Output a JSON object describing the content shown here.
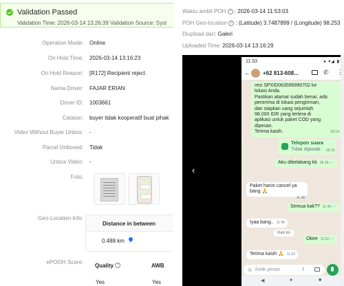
{
  "banner": {
    "title": "Validation Passed",
    "meta": "Validation Time: 2026-03-14 13:26:39    Validation Source: Syst"
  },
  "details": [
    {
      "label": "Operation Mode:",
      "value": "Online"
    },
    {
      "label": "On Hold Time:",
      "value": "2026-03-14 13:16:23"
    },
    {
      "label": "On Hold Reason:",
      "value": "[R172] Recipient reject"
    },
    {
      "label": "Nama Driver:",
      "value": "FAJAR ERIAN"
    },
    {
      "label": "Driver ID:",
      "value": "1003661"
    },
    {
      "label": "Catatan:",
      "value": "buyer tidak kooperatif buat pihak"
    },
    {
      "label": "Video Without Buyer Unbox:",
      "value": "-"
    },
    {
      "label": "Parcel Unboxed:",
      "value": "Tidak"
    },
    {
      "label": "Unbox Video:",
      "value": "-"
    },
    {
      "label": "Foto:",
      "value": ""
    },
    {
      "label": "Geo-Location Info:",
      "value": ""
    },
    {
      "label": "ePOOH Score:",
      "value": ""
    }
  ],
  "geo": {
    "header": "Distance in between",
    "distance": "0.488 km"
  },
  "score": {
    "quality_label": "Quality",
    "awb_label": "AWB",
    "quality_value": "Yes",
    "awb_value": "Yes"
  },
  "info": {
    "waktu_label": "Waktu ambil POH",
    "waktu_value": ": 2026-03-14 11:53:03",
    "geo_label": "POH Geo-location",
    "geo_value": ": (Latitude) 3.7487899 / (Longitude) 98.253",
    "upload_label": "Diupload dari:",
    "upload_value": "Galeri",
    "uploaded_label": "Uploaded Time:",
    "uploaded_value": "2026-03-14 13:16:29"
  },
  "phone": {
    "status_time": "11.53",
    "status_icons": "● ▾◢ ▮",
    "contact": "+62 813-608...",
    "msg1_lines": [
      "resi SPXID063596990702  ke",
      "lokasi Anda.",
      "Pastikan alamat sudah benar, ada",
      "penerima di lokasi pengiriman,",
      "dan siapkan uang sejumlah",
      "98.000 IDR  yang tertera di",
      "aplikasi untuk paket COD yang",
      "dipesan.",
      " Terima kasih."
    ],
    "msg1_time": "09.14",
    "voice_title": "Telepon suara",
    "voice_sub": "Tidak dijawab",
    "voice_time": "09.15",
    "msg2": "Aku dibelakang kk",
    "msg2_time": "09.16",
    "date_pill": "Hari ini",
    "msg3": "Paket harini cancel ya bang 🙏",
    "msg3_time": "11.48",
    "msg4": "Semua kak??",
    "msg4_time": "11.49",
    "msg5": "Iyaa bang..",
    "msg5_time": "11.49",
    "msg6": "Okee",
    "msg6_time": "11.52",
    "msg7": "Terima kasih 🙏",
    "msg7_time": "11.52",
    "composer_placeholder": "Ketik pesan"
  }
}
